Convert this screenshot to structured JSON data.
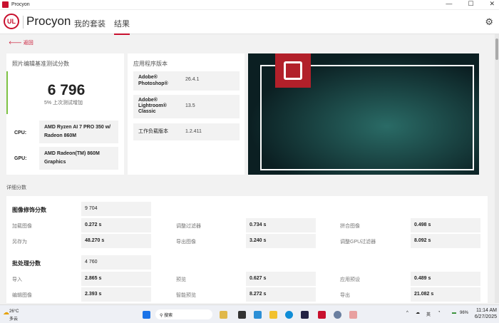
{
  "window": {
    "title": "Procyon",
    "min": "—",
    "max": "☐",
    "close": "✕"
  },
  "header": {
    "logo": "UL",
    "brand": "Procyon",
    "tabs": [
      {
        "label": "我的套装"
      },
      {
        "label": "结果"
      }
    ]
  },
  "nav": {
    "back": "返回"
  },
  "score_card": {
    "title": "照片编辑基准测试分数",
    "score": "6 796",
    "delta": "5% 上次测试增加",
    "cpu_label": "CPU:",
    "cpu": "AMD Ryzen AI 7 PRO 350 w/ Radeon 860M",
    "gpu_label": "GPU:",
    "gpu": "AMD Radeon(TM) 860M Graphics",
    "accent": "#7dc242"
  },
  "versions": {
    "title": "应用程序版本",
    "items": [
      {
        "name": "Adobe® Photoshop®",
        "value": "26.4.1"
      },
      {
        "name": "Adobe® Lightroom® Classic",
        "value": "13.5"
      },
      {
        "name": "工作负载版本",
        "value": "1.2.411"
      }
    ]
  },
  "detail": {
    "title": "详细分数",
    "retouch": {
      "label": "图像修饰分数",
      "score": "9 704",
      "rows": [
        [
          [
            "加载图像",
            "0.272 s"
          ],
          [
            "调整过滤器",
            "0.734 s"
          ],
          [
            "拼合图像",
            "0.498 s"
          ]
        ],
        [
          [
            "另存为",
            "48.270 s"
          ],
          [
            "导出图像",
            "3.240 s"
          ],
          [
            "调整GPU过滤器",
            "8.092 s"
          ]
        ]
      ]
    },
    "batch": {
      "label": "批处理分数",
      "score": "4 760",
      "rows": [
        [
          [
            "导入",
            "2.865 s"
          ],
          [
            "预览",
            "0.627 s"
          ],
          [
            "应用预设",
            "0.489 s"
          ]
        ],
        [
          [
            "编辑图像",
            "2.393 s"
          ],
          [
            "智能预览",
            "8.272 s"
          ],
          [
            "导出",
            "21.082 s"
          ]
        ]
      ]
    }
  },
  "taskbar": {
    "temp": "26°C",
    "weather": "多云",
    "search": "搜索",
    "ime": "英",
    "battery": "96%",
    "time": "11:14 AM",
    "date": "6/27/2025"
  },
  "colors": {
    "brand": "#c8102e"
  }
}
